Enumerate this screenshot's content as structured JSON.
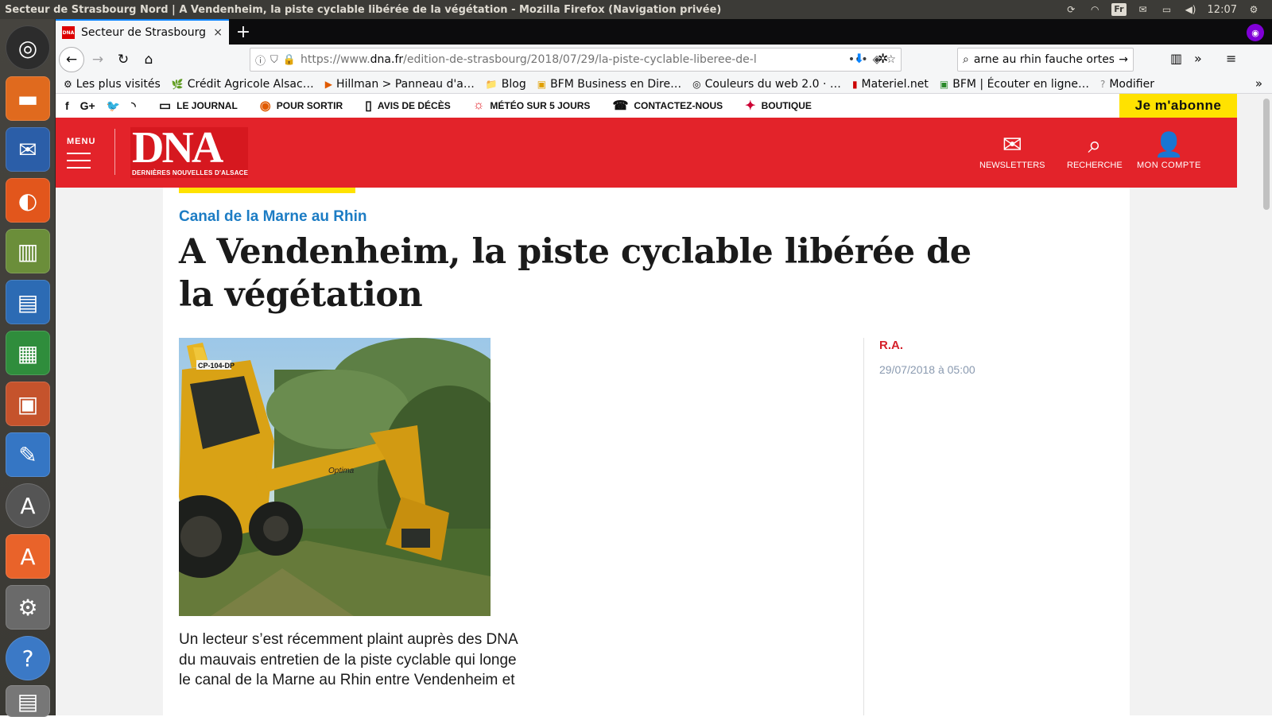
{
  "window": {
    "title": "Secteur de Strasbourg Nord | A Vendenheim, la piste cyclable libérée de la végétation - Mozilla Firefox (Navigation privée)",
    "keyboard_layout": "Fr",
    "clock": "12:07"
  },
  "tab": {
    "favicon_text": "DNA",
    "label": "Secteur de Strasbourg N",
    "close": "×"
  },
  "newtab_label": "+",
  "urlbar": {
    "url_prefix": "https://www.",
    "url_domain": "dna.fr",
    "url_path": "/edition-de-strasbourg/2018/07/29/la-piste-cyclable-liberee-de-l",
    "more": "•••"
  },
  "searchbar": {
    "value": "arne au rhin fauche ortes"
  },
  "bookmarks": [
    {
      "icon": "⚙",
      "label": "Les plus visités"
    },
    {
      "icon": "🌿",
      "label": "Crédit Agricole Alsac…"
    },
    {
      "icon": "▶",
      "label": "Hillman > Panneau d'a…"
    },
    {
      "icon": "📁",
      "label": "Blog"
    },
    {
      "icon": "▣",
      "label": "BFM Business en Dire…"
    },
    {
      "icon": "◎",
      "label": "Couleurs du web 2.0 · …"
    },
    {
      "icon": "▮",
      "label": "Materiel.net"
    },
    {
      "icon": "▣",
      "label": "BFM | Écouter en ligne…"
    },
    {
      "icon": "?",
      "label": "Modifier"
    }
  ],
  "bookmarks_more": "»",
  "site": {
    "util_links": [
      {
        "icon": "▭",
        "label": "LE JOURNAL"
      },
      {
        "icon": "◉",
        "label": "POUR SORTIR"
      },
      {
        "icon": "▯",
        "label": "AVIS DE DÉCÈS"
      },
      {
        "icon": "☼",
        "label": "MÉTÉO SUR 5 JOURS"
      },
      {
        "icon": "☎",
        "label": "CONTACTEZ-NOUS"
      },
      {
        "icon": "✦",
        "label": "BOUTIQUE"
      }
    ],
    "subscribe_label": "Je m'abonne",
    "menu_label": "MENU",
    "logo_text": "DNA",
    "logo_subtitle": "DERNIÈRES NOUVELLES D'ALSACE",
    "actions": {
      "newsletters": "NEWSLETTERS",
      "search": "RECHERCHE",
      "account": "MON COMPTE"
    },
    "brand_color": "#e3232a",
    "accent_yellow": "#ffe200"
  },
  "article": {
    "rubric": "Canal de la Marne au Rhin",
    "headline": "A Vendenheim, la piste cyclable libérée de la végétation",
    "author": "R.A.",
    "date": "29/07/2018 à 05:00",
    "photo_plate": "CP-104-DP",
    "photo_brand": "Optima",
    "lead": "Un lecteur s’est récemment plaint auprès des DNA du mauvais entretien de la piste cyclable qui longe le canal de la Marne au Rhin entre Vendenheim et"
  }
}
